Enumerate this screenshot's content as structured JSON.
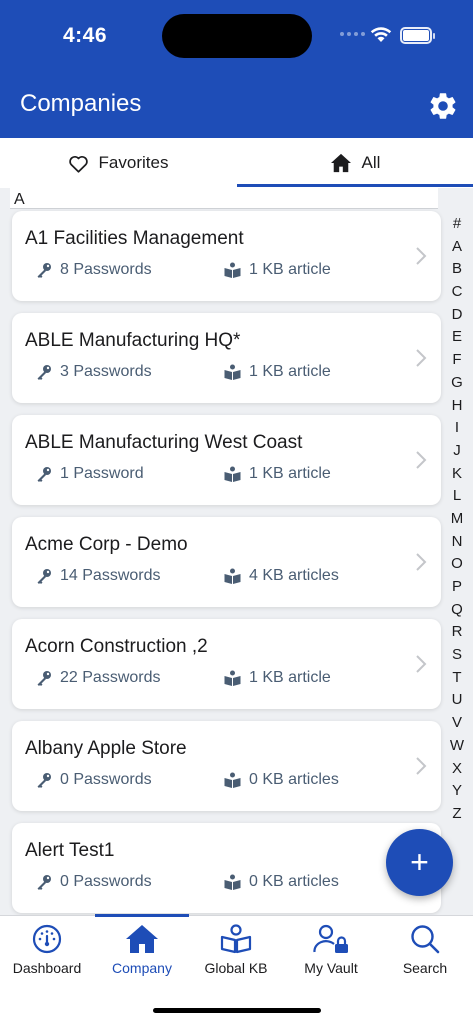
{
  "status": {
    "time": "4:46"
  },
  "header": {
    "title": "Companies"
  },
  "segment": {
    "favorites": "Favorites",
    "all": "All"
  },
  "section": {
    "letter": "A"
  },
  "companies": [
    {
      "name": "A1 Facilities Management",
      "passwords": "8 Passwords",
      "kb": "1 KB article"
    },
    {
      "name": "ABLE Manufacturing HQ*",
      "passwords": "3 Passwords",
      "kb": "1 KB article"
    },
    {
      "name": "ABLE Manufacturing West Coast",
      "passwords": "1 Password",
      "kb": "1 KB article"
    },
    {
      "name": "Acme Corp - Demo",
      "passwords": "14 Passwords",
      "kb": "4 KB articles"
    },
    {
      "name": "Acorn Construction ,2",
      "passwords": "22 Passwords",
      "kb": "1 KB article"
    },
    {
      "name": "Albany Apple Store",
      "passwords": "0 Passwords",
      "kb": "0 KB articles"
    },
    {
      "name": "Alert Test1",
      "passwords": "0 Passwords",
      "kb": "0 KB articles"
    }
  ],
  "index": [
    "#",
    "A",
    "B",
    "C",
    "D",
    "E",
    "F",
    "G",
    "H",
    "I",
    "J",
    "K",
    "L",
    "M",
    "N",
    "O",
    "P",
    "Q",
    "R",
    "S",
    "T",
    "U",
    "V",
    "W",
    "X",
    "Y",
    "Z"
  ],
  "fab": {
    "label": "+"
  },
  "tabs": {
    "dashboard": "Dashboard",
    "company": "Company",
    "global_kb": "Global KB",
    "my_vault": "My Vault",
    "search": "Search"
  },
  "colors": {
    "brand": "#1e4db7",
    "meta_text": "#4a5d73"
  }
}
